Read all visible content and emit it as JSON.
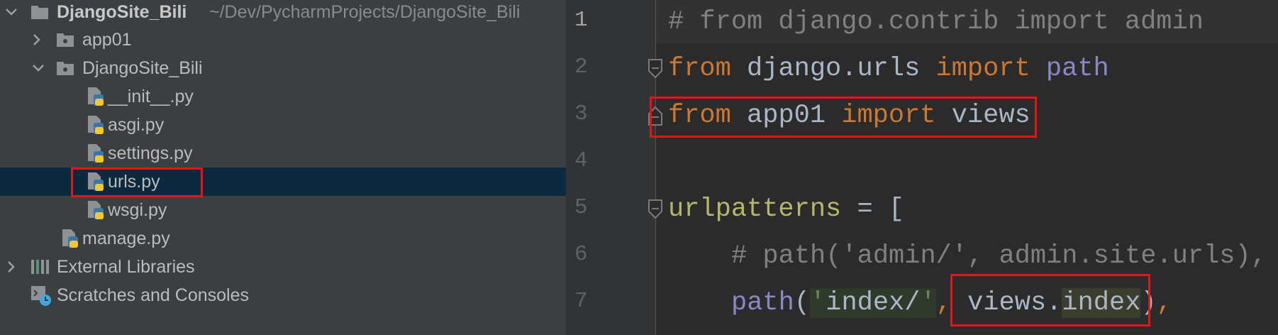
{
  "project_tree": {
    "root": {
      "name": "DjangoSite_Bili",
      "path": "~/Dev/PycharmProjects/DjangoSite_Bili",
      "expanded": true
    },
    "items": [
      {
        "label": "app01",
        "type": "folder",
        "expanded": false
      },
      {
        "label": "DjangoSite_Bili",
        "type": "folder",
        "expanded": true
      },
      {
        "label": "__init__.py",
        "type": "python-file"
      },
      {
        "label": "asgi.py",
        "type": "python-file"
      },
      {
        "label": "settings.py",
        "type": "python-file"
      },
      {
        "label": "urls.py",
        "type": "python-file",
        "selected": true
      },
      {
        "label": "wsgi.py",
        "type": "python-file"
      },
      {
        "label": "manage.py",
        "type": "python-file"
      },
      {
        "label": "External Libraries",
        "type": "libraries",
        "expanded": false
      },
      {
        "label": "Scratches and Consoles",
        "type": "scratches"
      }
    ]
  },
  "editor": {
    "line_numbers": [
      "1",
      "2",
      "3",
      "4",
      "5",
      "6",
      "7"
    ],
    "lines": {
      "l1": {
        "comment": "# from django.contrib import admin"
      },
      "l2": {
        "kw1": "from",
        "mod": " django.urls ",
        "kw2": "import",
        "name": " path"
      },
      "l3": {
        "kw1": "from",
        "mod": " app01 ",
        "kw2": "import",
        "name": " views"
      },
      "l5": {
        "var": "urlpatterns",
        "rest": " = ["
      },
      "l6": {
        "comment": "# path('admin/', admin.site.urls),"
      },
      "l7": {
        "fn": "path",
        "open": "(",
        "q1": "'",
        "str": "index/",
        "q2": "'",
        "comma1": ", ",
        "obj": "views.",
        "attr": "index",
        "close": ")",
        "comma2": ","
      }
    }
  },
  "colors": {
    "highlight_box": "#e5131a",
    "selection": "#0d293e",
    "keyword": "#cc7832",
    "comment": "#808080",
    "string": "#6a8759"
  },
  "icons": [
    "chevron-down-icon",
    "chevron-right-icon",
    "folder-icon",
    "python-file-icon",
    "libraries-icon",
    "scratches-icon",
    "fold-icon"
  ]
}
